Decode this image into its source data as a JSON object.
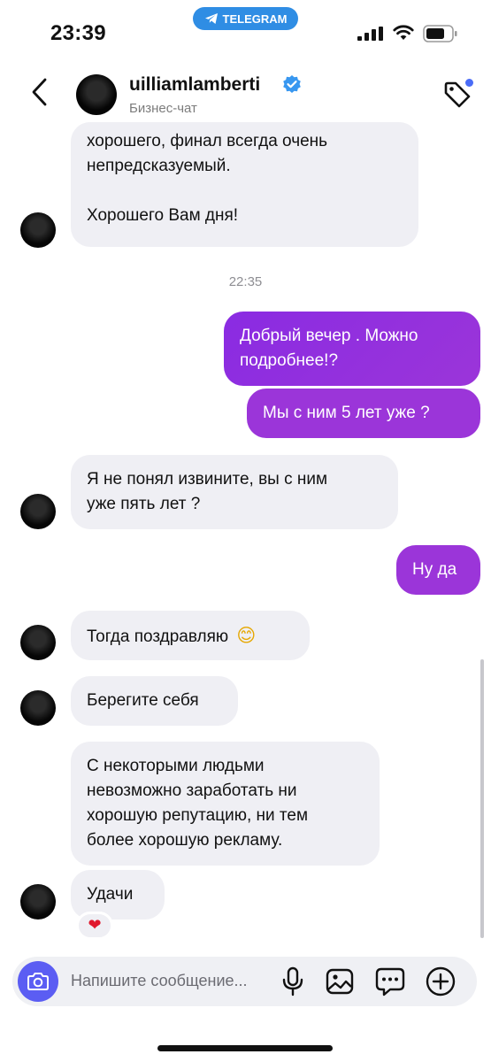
{
  "status_bar": {
    "time": "23:39",
    "app_pill": "TELEGRAM"
  },
  "header": {
    "name": "uilliamlamberti",
    "subtitle": "Бизнес-чат"
  },
  "messages": {
    "m1": {
      "line1": "хорошего, финал всегда очень",
      "line2": "непредсказуемый.",
      "line3": "Хорошего Вам дня!"
    },
    "timestamp": "22:35",
    "m2": {
      "line1": "Добрый вечер . Можно",
      "line2": "подробнее!?"
    },
    "m3": "Мы с ним 5 лет уже ?",
    "m4": {
      "line1": "Я не понял извините, вы с ним",
      "line2": "уже пять лет ?"
    },
    "m5": "Ну да",
    "m6": {
      "text": "Тогда поздравляю",
      "emoji": "😊"
    },
    "m7": "Берегите себя",
    "m8": {
      "line1": "С некоторыми людьми",
      "line2": "невозможно заработать ни",
      "line3": "хорошую репутацию, ни тем",
      "line4": "более хорошую рекламу."
    },
    "m9": {
      "text": "Удачи",
      "reaction": "❤"
    }
  },
  "composer": {
    "placeholder": "Напишите сообщение..."
  },
  "colors": {
    "accent": "#5b5df3",
    "outgoing_gradient_start": "#8a2be2",
    "outgoing_gradient_end": "#9b35d9",
    "incoming": "#efeff4",
    "telegram": "#2f8de4"
  },
  "icons": [
    "telegram-icon",
    "signal-icon",
    "wifi-icon",
    "battery-icon",
    "back-icon",
    "verified-icon",
    "tag-icon",
    "camera-icon",
    "mic-icon",
    "gallery-icon",
    "sticker-icon",
    "plus-icon"
  ]
}
